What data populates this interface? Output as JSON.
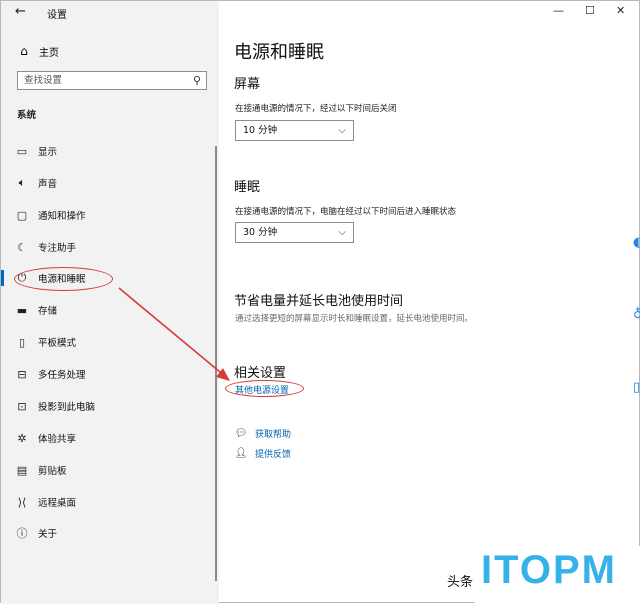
{
  "window": {
    "title": "设置",
    "controls": {
      "minimize": "—",
      "maximize": "☐",
      "close": "✕"
    }
  },
  "sidebar": {
    "home_label": "主页",
    "search_placeholder": "查找设置",
    "section_label": "系统",
    "items": [
      {
        "label": "显示",
        "icon": "monitor-icon"
      },
      {
        "label": "声音",
        "icon": "speaker-icon"
      },
      {
        "label": "通知和操作",
        "icon": "notification-icon"
      },
      {
        "label": "专注助手",
        "icon": "moon-icon"
      },
      {
        "label": "电源和睡眠",
        "icon": "power-icon",
        "selected": true
      },
      {
        "label": "存储",
        "icon": "storage-icon"
      },
      {
        "label": "平板模式",
        "icon": "tablet-icon"
      },
      {
        "label": "多任务处理",
        "icon": "multitask-icon"
      },
      {
        "label": "投影到此电脑",
        "icon": "project-icon"
      },
      {
        "label": "体验共享",
        "icon": "share-icon"
      },
      {
        "label": "剪贴板",
        "icon": "clipboard-icon"
      },
      {
        "label": "远程桌面",
        "icon": "remote-desktop-icon"
      },
      {
        "label": "关于",
        "icon": "info-icon"
      }
    ]
  },
  "main": {
    "title": "电源和睡眠",
    "screen": {
      "heading": "屏幕",
      "desc": "在接通电源的情况下，经过以下时间后关闭",
      "value": "10 分钟"
    },
    "sleep": {
      "heading": "睡眠",
      "desc": "在接通电源的情况下，电脑在经过以下时间后进入睡眠状态",
      "value": "30 分钟"
    },
    "battery": {
      "heading": "节省电量并延长电池使用时间",
      "desc": "通过选择更短的屏幕显示时长和睡眠设置，延长电池使用时间。"
    },
    "related": {
      "heading": "相关设置",
      "link": "其他电源设置"
    },
    "help": {
      "get_help": "获取帮助",
      "feedback": "提供反馈"
    }
  },
  "watermark": {
    "prefix": "头条",
    "logo": "ITOPM"
  },
  "colors": {
    "accent": "#0063b1",
    "annotation": "#d63b3b",
    "sidebar_bg": "#f2f2f2",
    "logo": "#36b2e8"
  }
}
